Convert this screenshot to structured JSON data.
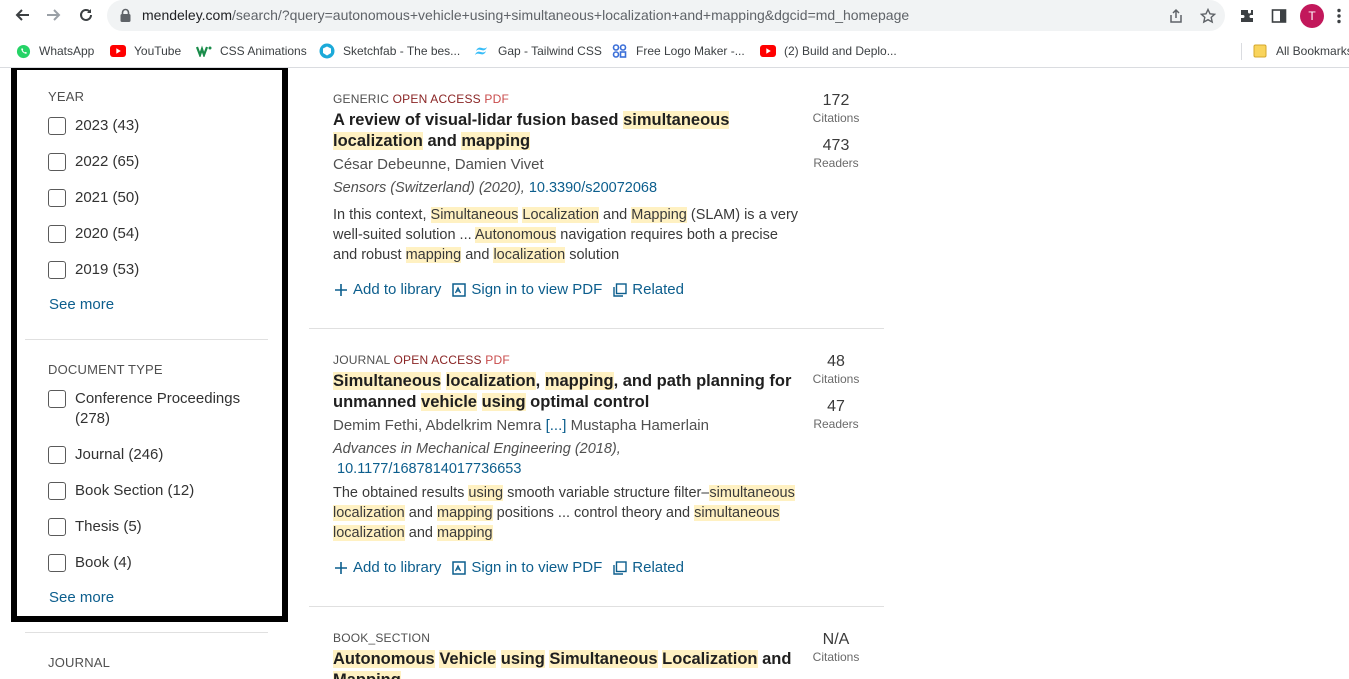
{
  "browser": {
    "url_host": "mendeley.com",
    "url_path": "/search/?query=autonomous+vehicle+using+simultaneous+localization+and+mapping&dgcid=md_homepage",
    "avatar_letter": "T",
    "bookmarks": [
      {
        "label": "WhatsApp",
        "icon": "whatsapp-icon",
        "color": "#25d366"
      },
      {
        "label": "YouTube",
        "icon": "youtube-icon",
        "color": "#ff0000"
      },
      {
        "label": "CSS Animations",
        "icon": "webflow-icon",
        "color": "#1a8c4a"
      },
      {
        "label": "Sketchfab - The bes...",
        "icon": "sketchfab-icon",
        "color": "#1caad9"
      },
      {
        "label": "Gap - Tailwind CSS",
        "icon": "tailwind-icon",
        "color": "#38bdf8"
      },
      {
        "label": "Free Logo Maker -...",
        "icon": "logo-maker-icon",
        "color": "#3b6fd8"
      },
      {
        "label": "(2) Build and Deplo...",
        "icon": "youtube-icon",
        "color": "#ff0000"
      }
    ],
    "all_bookmarks": "All Bookmarks"
  },
  "sidebar": {
    "year_title": "YEAR",
    "years": [
      "2023 (43)",
      "2022 (65)",
      "2021 (50)",
      "2020 (54)",
      "2019 (53)"
    ],
    "see_more_1": "See more",
    "doctype_title": "DOCUMENT TYPE",
    "doctypes": [
      "Conference Proceedings (278)",
      "Journal (246)",
      "Book Section (12)",
      "Thesis (5)",
      "Book (4)"
    ],
    "see_more_2": "See more",
    "journal_title": "JOURNAL"
  },
  "results": [
    {
      "type": "GENERIC",
      "open_access": "OPEN ACCESS",
      "pdf": "PDF",
      "title_parts": [
        "A review of visual-lidar fusion based ",
        "simultaneous",
        " ",
        "localization",
        " and ",
        "mapping"
      ],
      "authors": "César Debeunne, Damien Vivet",
      "source": "Sensors (Switzerland) (2020), ",
      "doi": "10.3390/s20072068",
      "abstract_parts": [
        "In this context, ",
        "Simultaneous",
        " ",
        "Localization",
        " and ",
        "Mapping",
        " (SLAM) is a very well-suited solution ... ",
        "Autonomous",
        " navigation requires both a precise and robust ",
        "mapping",
        " and ",
        "localization",
        " solution"
      ],
      "citations": "172",
      "citations_label": "Citations",
      "readers": "473",
      "readers_label": "Readers"
    },
    {
      "type": "JOURNAL",
      "open_access": "OPEN ACCESS",
      "pdf": "PDF",
      "title_parts": [
        "Simultaneous",
        " ",
        "localization",
        ", ",
        "mapping",
        ", and path planning for unmanned ",
        "vehicle",
        " ",
        "using",
        " optimal control"
      ],
      "authors_a": "Demim Fethi, Abdelkrim Nemra ",
      "authors_more": "[...]",
      "authors_b": " Mustapha Hamerlain",
      "source": "Advances in Mechanical Engineering (2018),",
      "doi": "10.1177/1687814017736653",
      "abstract_parts": [
        "The obtained results ",
        "using",
        " smooth variable structure filter–",
        "simultaneous",
        " ",
        "localization",
        " and ",
        "mapping",
        " positions ... control theory and ",
        "simultaneous",
        " ",
        "localization",
        " and ",
        "mapping"
      ],
      "citations": "48",
      "citations_label": "Citations",
      "readers": "47",
      "readers_label": "Readers"
    },
    {
      "type": "BOOK_SECTION",
      "title_parts": [
        "Autonomous",
        " ",
        "Vehicle",
        " ",
        "using",
        " ",
        "Simultaneous",
        " ",
        "Localization",
        " and ",
        "Mapping"
      ],
      "citations": "N/A",
      "citations_label": "Citations"
    }
  ],
  "actions": {
    "add": "Add to library",
    "signin": "Sign in to view PDF",
    "related": "Related"
  },
  "colors": {
    "link": "#0c5e8d",
    "highlight": "#fff1c2",
    "open_access": "#8a2525"
  }
}
